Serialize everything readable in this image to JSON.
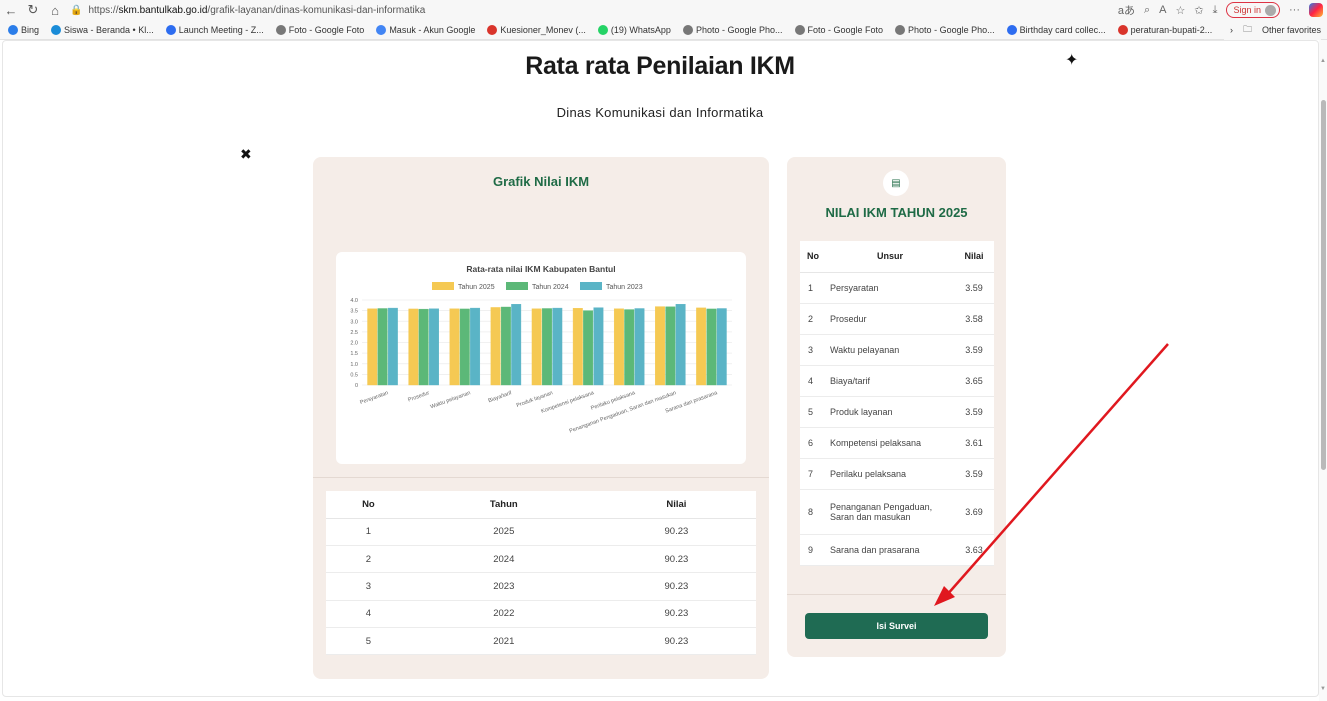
{
  "browser": {
    "url_prefix": "https://",
    "url_host": "skm.bantulkab.go.id",
    "url_path": "/grafik-layanan/dinas-komunikasi-dan-informatika",
    "sign_in": "Sign in",
    "bookmarks": [
      {
        "label": "Bing",
        "color": "#2b7de9"
      },
      {
        "label": "Siswa - Beranda • Kl...",
        "color": "#1a8cd8"
      },
      {
        "label": "Launch Meeting - Z...",
        "color": "#2d6cf0"
      },
      {
        "label": "Foto - Google Foto",
        "color": "#777777"
      },
      {
        "label": "Masuk - Akun Google",
        "color": "#4285f4"
      },
      {
        "label": "Kuesioner_Monev (...",
        "color": "#d9342b"
      },
      {
        "label": "(19) WhatsApp",
        "color": "#25d366"
      },
      {
        "label": "Photo - Google Pho...",
        "color": "#777777"
      },
      {
        "label": "Foto - Google Foto",
        "color": "#777777"
      },
      {
        "label": "Photo - Google Pho...",
        "color": "#777777"
      },
      {
        "label": "Birthday card collec...",
        "color": "#2d6cf0"
      },
      {
        "label": "peraturan-bupati-2...",
        "color": "#d9342b"
      }
    ],
    "other_favorites": "Other favorites"
  },
  "page": {
    "title": "Rata rata Penilaian IKM",
    "subtitle": "Dinas Komunikasi dan Informatika"
  },
  "left_panel": {
    "title": "Grafik Nilai IKM",
    "table_headers": [
      "No",
      "Tahun",
      "Nilai"
    ],
    "rows": [
      [
        "1",
        "2025",
        "90.23"
      ],
      [
        "2",
        "2024",
        "90.23"
      ],
      [
        "3",
        "2023",
        "90.23"
      ],
      [
        "4",
        "2022",
        "90.23"
      ],
      [
        "5",
        "2021",
        "90.23"
      ]
    ]
  },
  "right_panel": {
    "title": "NILAI IKM TAHUN 2025",
    "table_headers": [
      "No",
      "Unsur",
      "Nilai"
    ],
    "rows": [
      [
        "1",
        "Persyaratan",
        "3.59"
      ],
      [
        "2",
        "Prosedur",
        "3.58"
      ],
      [
        "3",
        "Waktu pelayanan",
        "3.59"
      ],
      [
        "4",
        "Biaya/tarif",
        "3.65"
      ],
      [
        "5",
        "Produk layanan",
        "3.59"
      ],
      [
        "6",
        "Kompetensi pelaksana",
        "3.61"
      ],
      [
        "7",
        "Perilaku pelaksana",
        "3.59"
      ],
      [
        "8",
        "Penanganan Pengaduan, Saran dan masukan",
        "3.69"
      ],
      [
        "9",
        "Sarana dan prasarana",
        "3.63"
      ]
    ],
    "button_label": "Isi Survei"
  },
  "colors": {
    "accent_green": "#1f6b46",
    "button_green": "#1f6b53",
    "panel_bg": "#f5ede8",
    "annotation_arrow": "#e0181f"
  },
  "chart_data": {
    "type": "bar",
    "title": "Rata-rata nilai IKM Kabupaten Bantul",
    "categories": [
      "Persyaratan",
      "Prosedur",
      "Waktu pelayanan",
      "Biaya/tarif",
      "Produk layanan",
      "Kompetensi pelaksana",
      "Perilaku pelaksana",
      "Penanganan Pengaduan, Saran dan masukan",
      "Sarana dan prasarana"
    ],
    "series": [
      {
        "name": "Tahun 2025",
        "color": "#f5c953",
        "values": [
          3.59,
          3.58,
          3.59,
          3.65,
          3.59,
          3.61,
          3.59,
          3.69,
          3.63
        ]
      },
      {
        "name": "Tahun 2024",
        "color": "#5cb878",
        "values": [
          3.6,
          3.57,
          3.58,
          3.67,
          3.6,
          3.5,
          3.55,
          3.68,
          3.58
        ]
      },
      {
        "name": "Tahun 2023",
        "color": "#5ab4c6",
        "values": [
          3.62,
          3.59,
          3.62,
          3.8,
          3.62,
          3.64,
          3.6,
          3.8,
          3.6
        ]
      }
    ],
    "ylim": [
      0,
      4.0
    ],
    "yticks": [
      "0",
      "0.5",
      "1.0",
      "1.5",
      "2.0",
      "2.5",
      "3.0",
      "3.5",
      "4.0"
    ],
    "legend": "top",
    "grid": true
  }
}
